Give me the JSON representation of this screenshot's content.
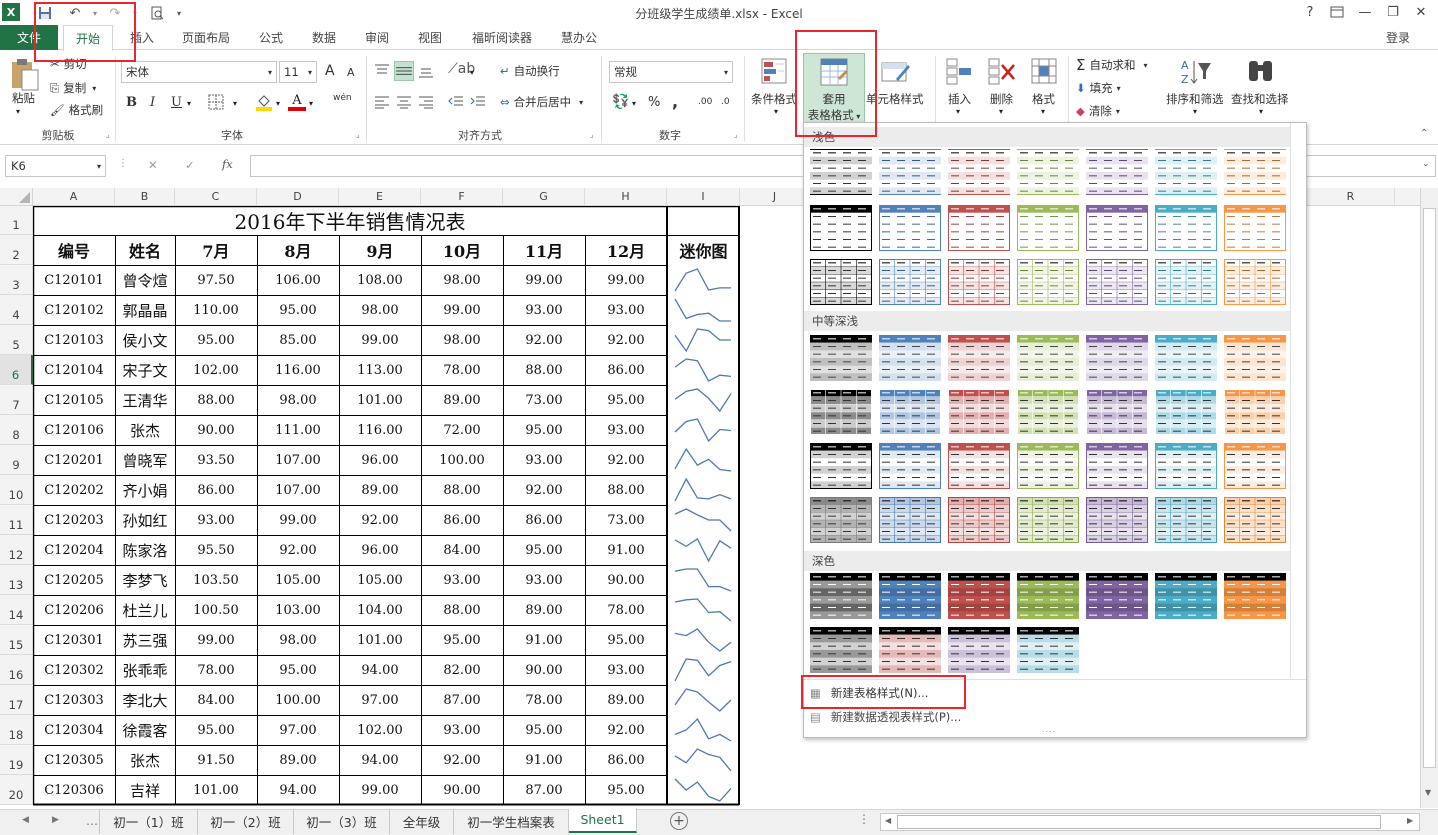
{
  "window": {
    "title": "分班级学生成绩单.xlsx - Excel",
    "help": "?",
    "user": "登录"
  },
  "tabs": [
    {
      "label": "文件"
    },
    {
      "label": "开始"
    },
    {
      "label": "插入"
    },
    {
      "label": "页面布局"
    },
    {
      "label": "公式"
    },
    {
      "label": "数据"
    },
    {
      "label": "审阅"
    },
    {
      "label": "视图"
    },
    {
      "label": "福昕阅读器"
    },
    {
      "label": "慧办公"
    }
  ],
  "ribbon": {
    "clipboard": {
      "paste": "粘贴",
      "cut": "剪切",
      "copy": "复制",
      "format_painter": "格式刷",
      "label": "剪贴板"
    },
    "font": {
      "name": "宋体",
      "size": "11",
      "grow": "A",
      "shrink": "A",
      "bold": "B",
      "italic": "I",
      "underline": "U",
      "phonetic": "wén",
      "label": "字体"
    },
    "alignment": {
      "wrap": "自动换行",
      "merge": "合并后居中",
      "label": "对齐方式"
    },
    "number": {
      "format": "常规",
      "percent": "%",
      "comma": ",",
      "inc_decimal": ".00",
      "dec_decimal": ".0",
      "label": "数字"
    },
    "styles": {
      "conditional": "条件格式",
      "table_line1": "套用",
      "table_line2": "表格格式",
      "cell_styles": "单元格样式"
    },
    "cells": {
      "insert": "插入",
      "delete": "删除",
      "format": "格式"
    },
    "editing": {
      "autosum": "自动求和",
      "fill": "填充",
      "clear": "清除",
      "sort": "排序和筛选",
      "find": "查找和选择"
    }
  },
  "formula_bar": {
    "name_box": "K6",
    "fx": "fx",
    "cancel": "✕",
    "enter": "✓",
    "content": ""
  },
  "columns": [
    "A",
    "B",
    "C",
    "D",
    "E",
    "F",
    "G",
    "H",
    "I",
    "J",
    "R"
  ],
  "rows": [
    "1",
    "2",
    "3",
    "4",
    "5",
    "6",
    "7",
    "8",
    "9",
    "10",
    "11",
    "12",
    "13",
    "14",
    "15",
    "16",
    "17",
    "18",
    "19",
    "20"
  ],
  "sheet": {
    "title": "2016年下半年销售情况表",
    "headers": [
      "编号",
      "姓名",
      "7月",
      "8月",
      "9月",
      "10月",
      "11月",
      "12月",
      "迷你图"
    ],
    "data": [
      [
        "C120101",
        "曾令煊",
        "97.50",
        "106.00",
        "108.00",
        "98.00",
        "99.00",
        "99.00"
      ],
      [
        "C120102",
        "郭晶晶",
        "110.00",
        "95.00",
        "98.00",
        "99.00",
        "93.00",
        "93.00"
      ],
      [
        "C120103",
        "侯小文",
        "95.00",
        "85.00",
        "99.00",
        "98.00",
        "92.00",
        "92.00"
      ],
      [
        "C120104",
        "宋子文",
        "102.00",
        "116.00",
        "113.00",
        "78.00",
        "88.00",
        "86.00"
      ],
      [
        "C120105",
        "王清华",
        "88.00",
        "98.00",
        "101.00",
        "89.00",
        "73.00",
        "95.00"
      ],
      [
        "C120106",
        "张杰",
        "90.00",
        "111.00",
        "116.00",
        "72.00",
        "95.00",
        "93.00"
      ],
      [
        "C120201",
        "曾晓军",
        "93.50",
        "107.00",
        "96.00",
        "100.00",
        "93.00",
        "92.00"
      ],
      [
        "C120202",
        "齐小娟",
        "86.00",
        "107.00",
        "89.00",
        "88.00",
        "92.00",
        "88.00"
      ],
      [
        "C120203",
        "孙如红",
        "93.00",
        "99.00",
        "92.00",
        "86.00",
        "86.00",
        "73.00"
      ],
      [
        "C120204",
        "陈家洛",
        "95.50",
        "92.00",
        "96.00",
        "84.00",
        "95.00",
        "91.00"
      ],
      [
        "C120205",
        "李梦飞",
        "103.50",
        "105.00",
        "105.00",
        "93.00",
        "93.00",
        "90.00"
      ],
      [
        "C120206",
        "杜兰儿",
        "100.50",
        "103.00",
        "104.00",
        "88.00",
        "89.00",
        "78.00"
      ],
      [
        "C120301",
        "苏三强",
        "99.00",
        "98.00",
        "101.00",
        "95.00",
        "91.00",
        "95.00"
      ],
      [
        "C120302",
        "张乖乖",
        "78.00",
        "95.00",
        "94.00",
        "82.00",
        "90.00",
        "93.00"
      ],
      [
        "C120303",
        "李北大",
        "84.00",
        "100.00",
        "97.00",
        "87.00",
        "78.00",
        "89.00"
      ],
      [
        "C120304",
        "徐霞客",
        "95.00",
        "97.00",
        "102.00",
        "93.00",
        "95.00",
        "92.00"
      ],
      [
        "C120305",
        "张杰",
        "91.50",
        "89.00",
        "94.00",
        "92.00",
        "91.00",
        "86.00"
      ],
      [
        "C120306",
        "吉祥",
        "101.00",
        "94.00",
        "99.00",
        "90.00",
        "87.00",
        "95.00"
      ]
    ]
  },
  "gallery": {
    "light_label": "浅色",
    "medium_label": "中等深浅",
    "dark_label": "深色",
    "new_table_style": "新建表格样式(N)...",
    "new_pivot_style": "新建数据透视表样式(P)...",
    "colors": [
      "#000000",
      "#4f81bd",
      "#c0504d",
      "#9bbb59",
      "#8064a2",
      "#4bacc6",
      "#f79646"
    ]
  },
  "sheet_tabs": [
    "初一（1）班",
    "初一（2）班",
    "初一（3）班",
    "全年级",
    "初一学生档案表",
    "Sheet1"
  ],
  "accent": "#217346"
}
